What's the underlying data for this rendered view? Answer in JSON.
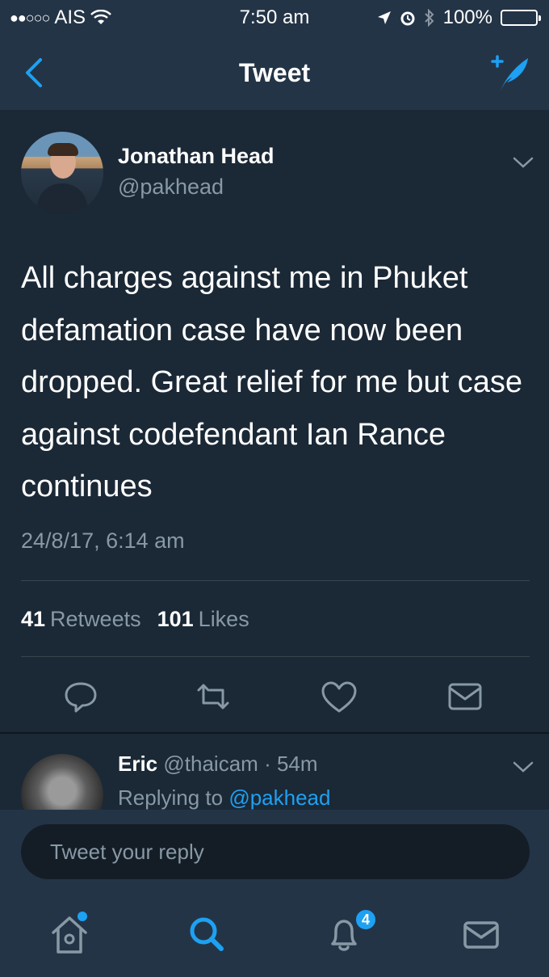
{
  "status_bar": {
    "signal": "●●○○○",
    "carrier": "AIS",
    "time": "7:50 am",
    "battery": "100%"
  },
  "nav": {
    "title": "Tweet",
    "back_icon": "chevron-left-icon",
    "compose_icon": "compose-tweet-icon"
  },
  "tweet": {
    "author_name": "Jonathan Head",
    "author_handle": "@pakhead",
    "text": "All charges against me in Phuket defamation case have now been dropped. Great relief for me but case against codefendant Ian Rance continues",
    "timestamp": "24/8/17, 6:14 am",
    "retweets_count": "41",
    "retweets_label": "Retweets",
    "likes_count": "101",
    "likes_label": "Likes",
    "actions": [
      "reply-icon",
      "retweet-icon",
      "like-icon",
      "direct-message-icon"
    ]
  },
  "reply": {
    "name": "Eric",
    "handle": "@thaicam",
    "separator": "·",
    "time": "54m",
    "replying_prefix": "Replying to",
    "replying_handle": "@pakhead"
  },
  "composer": {
    "placeholder": "Tweet your reply"
  },
  "tab_bar": {
    "tabs": [
      "home-icon",
      "search-icon",
      "notifications-icon",
      "messages-icon"
    ],
    "notification_badge": "4"
  },
  "colors": {
    "background": "#1b2836",
    "bar": "#243447",
    "accent": "#1da1f2",
    "secondary_text": "#8899a6"
  }
}
